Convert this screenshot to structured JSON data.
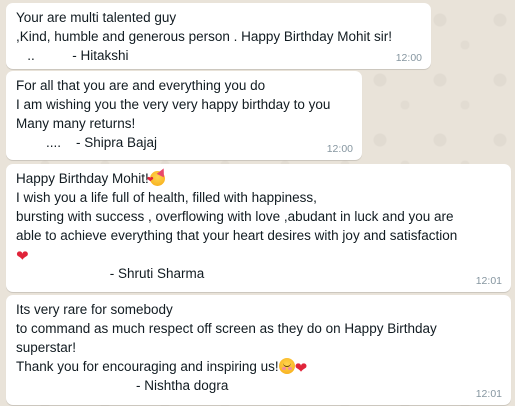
{
  "messages": [
    {
      "lines": [
        "Your are multi talented guy",
        ",Kind, humble and generous person . Happy Birthday Mohit sir!",
        "   ..          - Hitakshi"
      ],
      "time": "12:00"
    },
    {
      "lines": [
        "For all that you are and everything you do",
        "I am wishing you the very very happy birthday to you",
        "Many many returns!",
        "        ....    - Shipra Bajaj"
      ],
      "time": "12:00"
    },
    {
      "lines": [
        "Happy Birthday Mohit!",
        "I wish you a life full of health, filled with happiness,",
        "bursting with success , overflowing with love ,abudant in luck and you are",
        "able to achieve everything that your heart desires with joy and satisfaction",
        "",
        "                         - Shruti Sharma"
      ],
      "time": "12:01"
    },
    {
      "lines": [
        "Its very rare for somebody",
        "to command as much respect off screen as they do on Happy Birthday",
        "superstar!",
        "Thank you for encouraging and inspiring us!",
        "                                - Nishtha dogra"
      ],
      "time": "12:01"
    }
  ],
  "icons": {
    "party_face": "smiling-face-with-hearts-icon",
    "heart": "red-heart-icon",
    "smile": "smiling-face-icon"
  },
  "colors": {
    "wallpaper": "#e9e3d9",
    "bubble": "#ffffff",
    "timestamp": "#8696a0",
    "heart": "#e0243a"
  }
}
